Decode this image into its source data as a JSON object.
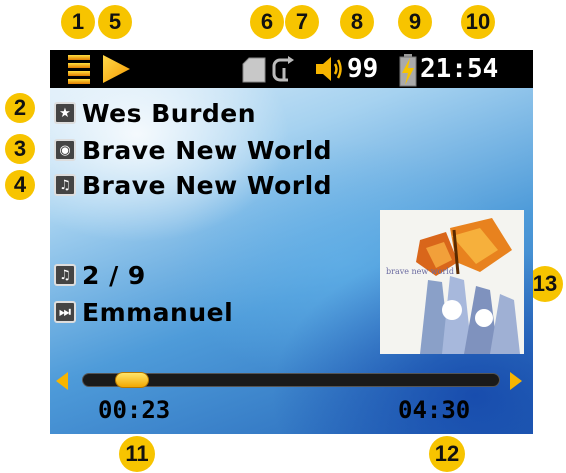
{
  "callouts": [
    "1",
    "5",
    "6",
    "7",
    "8",
    "9",
    "10",
    "2",
    "3",
    "4",
    "13",
    "11",
    "12"
  ],
  "status": {
    "volume": "99",
    "clock": "21:54"
  },
  "track": {
    "artist": "Wes Burden",
    "album": "Brave New World",
    "title": "Brave New World",
    "position": "2 / 9",
    "next": "Emmanuel"
  },
  "playback": {
    "elapsed": "00:23",
    "total": "04:30",
    "progress": 0.085
  },
  "cover_art": {
    "text": "brave new world"
  },
  "icons": {
    "menu": "list-menu-icon",
    "play": "play-icon",
    "card": "memory-card-icon",
    "repeat": "repeat-icon",
    "volume": "speaker-icon",
    "battery": "battery-charging-icon",
    "artist": "star-icon",
    "album": "disc-icon",
    "song": "music-note-icon",
    "playlist": "playlist-icon",
    "next": "next-track-icon"
  },
  "colors": {
    "accent": "#f7c400",
    "statusbar": "#000000",
    "text": "#000000"
  }
}
